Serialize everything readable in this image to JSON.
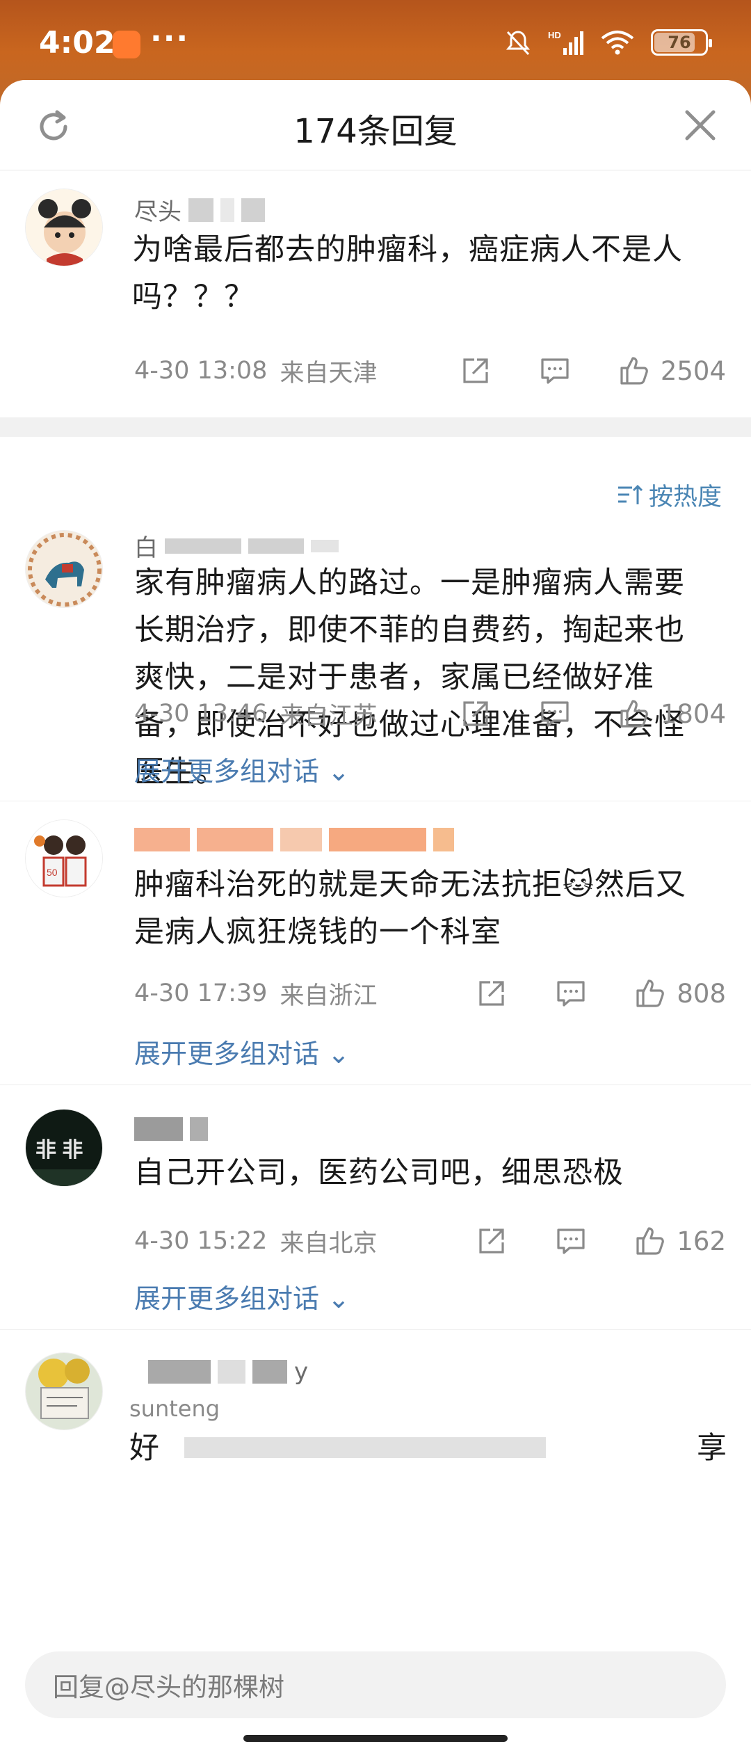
{
  "status_bar": {
    "time": "4:02",
    "more_dots": "···",
    "battery": "76"
  },
  "sheet": {
    "title": "174条回复",
    "refresh_icon": "refresh-icon",
    "close_icon": "close-icon"
  },
  "root_comment": {
    "username": "尽头",
    "text_line1": "为啥最后都去的肿瘤科，癌症病人不是人",
    "text_line2": "吗？？？",
    "time": "4-30 13:08",
    "location": "来自天津",
    "likes": "2504"
  },
  "sort_label": "按热度",
  "replies": [
    {
      "username": "白",
      "lines": [
        "家有肿瘤病人的路过。一是肿瘤病人需要",
        "长期治疗，即使不菲的自费药，掏起来也",
        "爽快，二是对于患者，家属已经做好准",
        "备，即使治不好也做过心理准备，不会怪",
        "医生。"
      ],
      "time": "4-30 13:46",
      "location": "来自江苏",
      "likes": "1804",
      "expand": "展开更多组对话"
    },
    {
      "username": "",
      "lines": [
        "肿瘤科治死的就是天命无法抗拒🐱然后又",
        "是病人疯狂烧钱的一个科室"
      ],
      "time": "4-30 17:39",
      "location": "来自浙江",
      "likes": "808",
      "expand": "展开更多组对话"
    },
    {
      "username": "",
      "lines": [
        "自己开公司，医药公司吧，细思恐极"
      ],
      "time": "4-30 15:22",
      "location": "来自北京",
      "likes": "162",
      "expand": "展开更多组对话"
    },
    {
      "username": "y",
      "subname": "sunteng",
      "lines": [
        "好",
        "享"
      ]
    }
  ],
  "input": {
    "placeholder": "回复@尽头的那棵树"
  },
  "colors": {
    "accent_blue": "#4a7bb0",
    "status_gradient": "#c9661f"
  }
}
